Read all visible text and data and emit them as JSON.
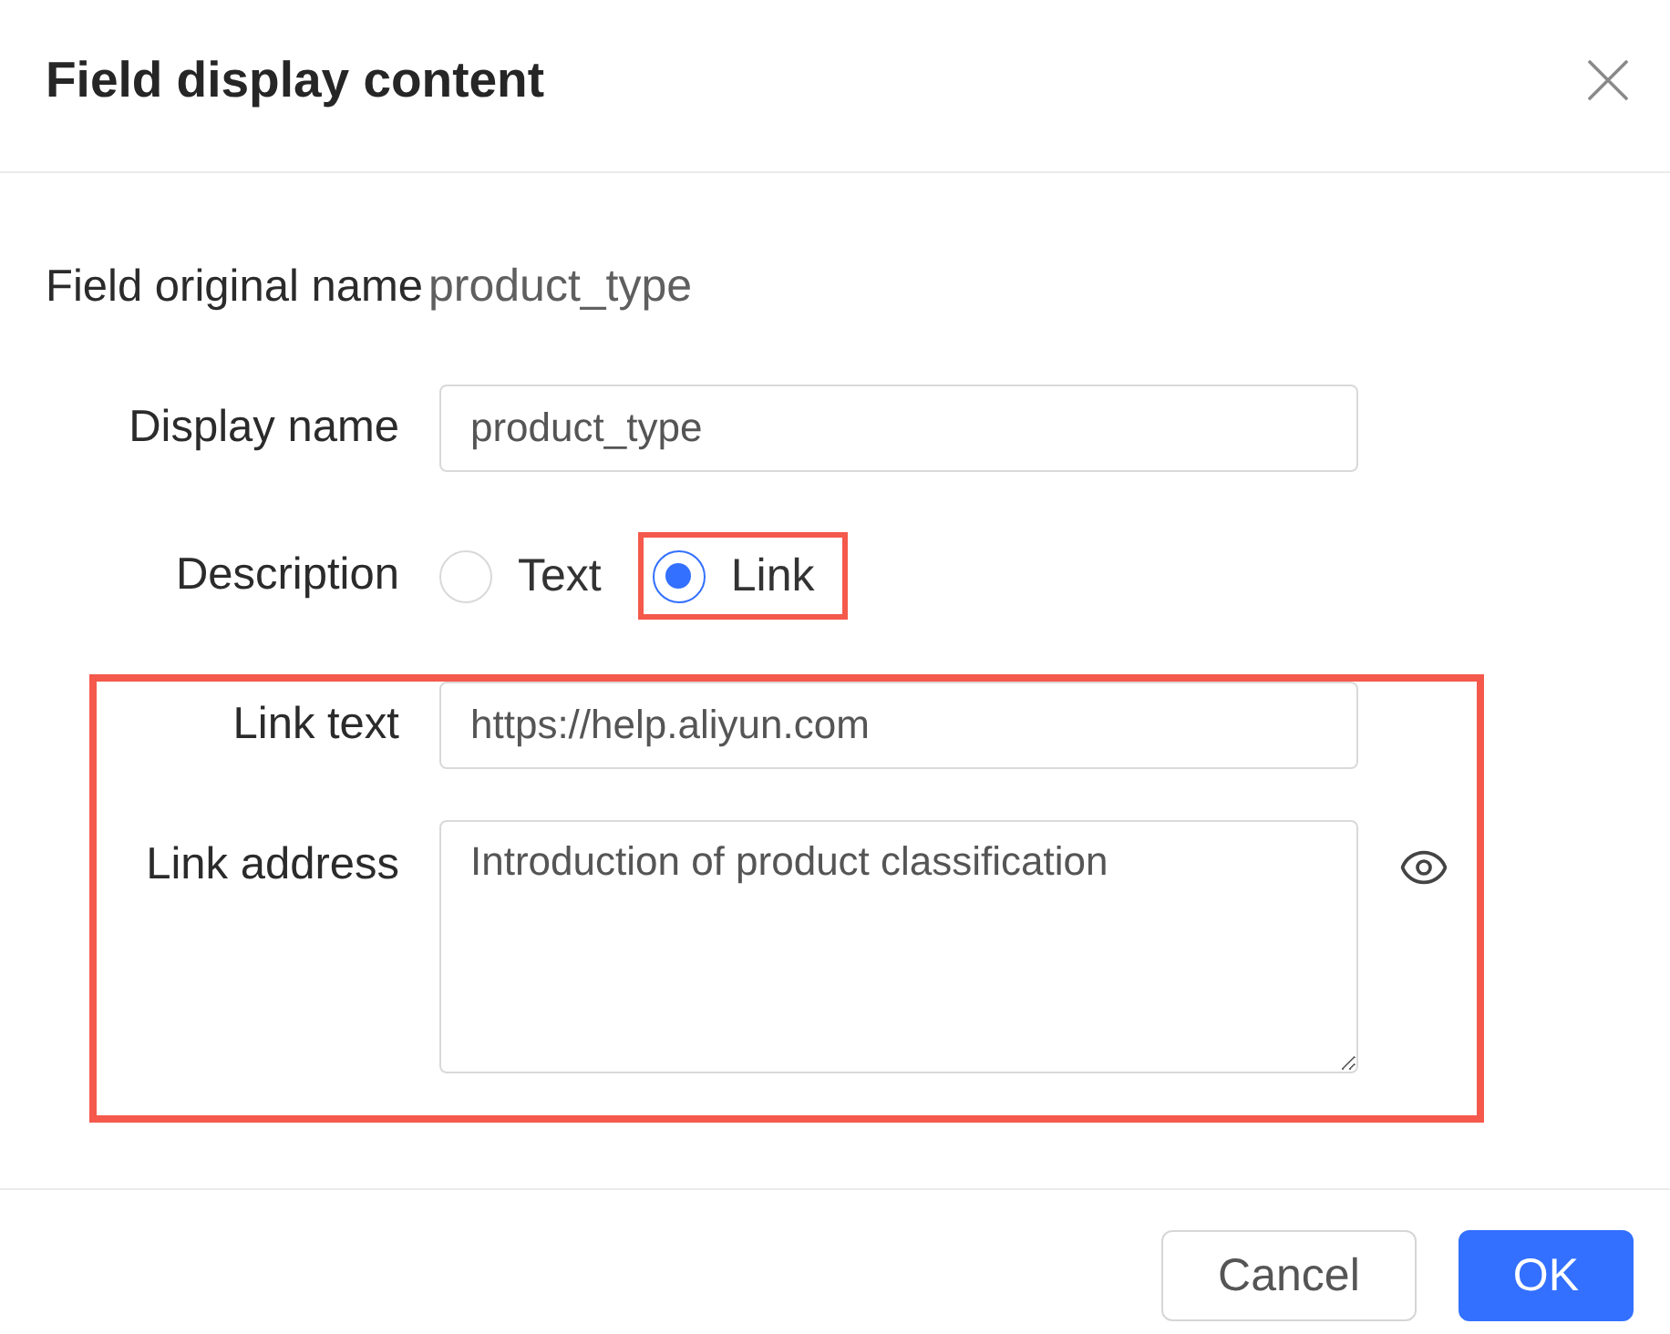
{
  "dialog": {
    "title": "Field display content"
  },
  "original_name": {
    "label": "Field original name",
    "value": "product_type"
  },
  "display_name": {
    "label": "Display name",
    "value": "product_type"
  },
  "description": {
    "label": "Description",
    "options": [
      {
        "label": "Text",
        "selected": false,
        "highlighted": false
      },
      {
        "label": "Link",
        "selected": true,
        "highlighted": true
      }
    ]
  },
  "link_section": {
    "highlighted": true,
    "fields": [
      {
        "kind": "input",
        "label": "Link text",
        "value": "https://help.aliyun.com"
      },
      {
        "kind": "textarea",
        "label": "Link address",
        "value": "Introduction of product classification"
      }
    ]
  },
  "buttons": [
    {
      "label": "Cancel",
      "kind": "default"
    },
    {
      "label": "OK",
      "kind": "primary"
    }
  ]
}
